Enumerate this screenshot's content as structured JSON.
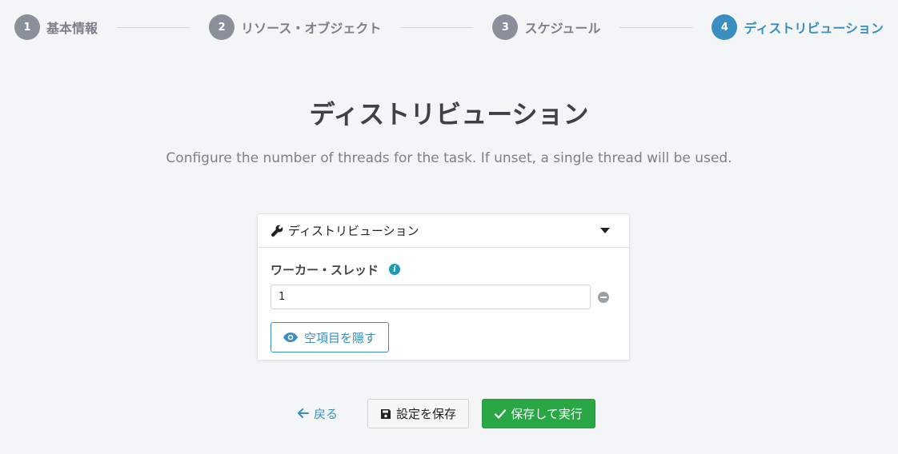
{
  "stepper": {
    "steps": [
      {
        "number": "1",
        "label": "基本情報",
        "state": "inactive"
      },
      {
        "number": "2",
        "label": "リソース・オブジェクト",
        "state": "inactive"
      },
      {
        "number": "3",
        "label": "スケジュール",
        "state": "inactive"
      },
      {
        "number": "4",
        "label": "ディストリビューション",
        "state": "active"
      }
    ]
  },
  "page": {
    "title": "ディストリビューション",
    "description": "Configure the number of threads for the task. If unset, a single thread will be used."
  },
  "card": {
    "header_title": "ディストリビューション",
    "header_icon": "wrench-icon",
    "field": {
      "label": "ワーカー・スレッド",
      "value": "1"
    },
    "hide_empty_label": "空項目を隠す"
  },
  "footer": {
    "back_label": "戻る",
    "save_label": "設定を保存",
    "run_label": "保存して実行"
  },
  "colors": {
    "accent": "#3a8fc0",
    "success": "#2aa745",
    "info": "#1c9bb6",
    "inactive_step": "#8a9099"
  }
}
